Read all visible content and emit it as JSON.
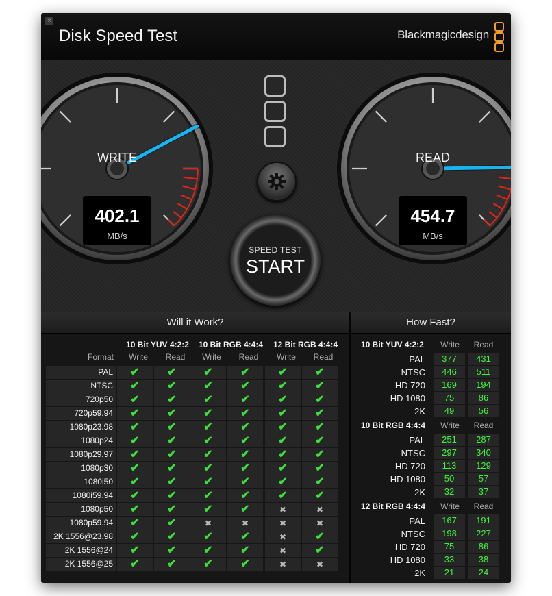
{
  "window": {
    "title": "Disk Speed Test",
    "brand": "Blackmagicdesign",
    "close_glyph": "×"
  },
  "colors": {
    "accent": "#f29b2b",
    "needle": "#19b4f0",
    "check": "#3ee03e",
    "value": "#3ef03e",
    "redzone": "#d8261a"
  },
  "gauges": {
    "write": {
      "label": "WRITE",
      "value": "402.1",
      "unit": "MB/s",
      "needle_fraction": 0.73
    },
    "read": {
      "label": "READ",
      "value": "454.7",
      "unit": "MB/s",
      "needle_fraction": 0.83
    }
  },
  "start_button": {
    "top_label": "SPEED TEST",
    "main_label": "START"
  },
  "settings_button": {
    "icon": "gear-icon"
  },
  "will_it_work": {
    "title": "Will it Work?",
    "format_header": "Format",
    "groups": [
      "10 Bit YUV 4:2:2",
      "10 Bit RGB 4:4:4",
      "12 Bit RGB 4:4:4"
    ],
    "sub_headers": [
      "Write",
      "Read",
      "Write",
      "Read",
      "Write",
      "Read"
    ],
    "rows": [
      {
        "format": "PAL",
        "cells": [
          1,
          1,
          1,
          1,
          1,
          1
        ]
      },
      {
        "format": "NTSC",
        "cells": [
          1,
          1,
          1,
          1,
          1,
          1
        ]
      },
      {
        "format": "720p50",
        "cells": [
          1,
          1,
          1,
          1,
          1,
          1
        ]
      },
      {
        "format": "720p59.94",
        "cells": [
          1,
          1,
          1,
          1,
          1,
          1
        ]
      },
      {
        "format": "1080p23.98",
        "cells": [
          1,
          1,
          1,
          1,
          1,
          1
        ]
      },
      {
        "format": "1080p24",
        "cells": [
          1,
          1,
          1,
          1,
          1,
          1
        ]
      },
      {
        "format": "1080p29.97",
        "cells": [
          1,
          1,
          1,
          1,
          1,
          1
        ]
      },
      {
        "format": "1080p30",
        "cells": [
          1,
          1,
          1,
          1,
          1,
          1
        ]
      },
      {
        "format": "1080i50",
        "cells": [
          1,
          1,
          1,
          1,
          1,
          1
        ]
      },
      {
        "format": "1080i59.94",
        "cells": [
          1,
          1,
          1,
          1,
          1,
          1
        ]
      },
      {
        "format": "1080p50",
        "cells": [
          1,
          1,
          1,
          1,
          0,
          0
        ]
      },
      {
        "format": "1080p59.94",
        "cells": [
          1,
          1,
          0,
          0,
          0,
          0
        ]
      },
      {
        "format": "2K 1556@23.98",
        "cells": [
          1,
          1,
          1,
          1,
          0,
          1
        ]
      },
      {
        "format": "2K 1556@24",
        "cells": [
          1,
          1,
          1,
          1,
          0,
          1
        ]
      },
      {
        "format": "2K 1556@25",
        "cells": [
          1,
          1,
          1,
          1,
          0,
          0
        ]
      }
    ]
  },
  "how_fast": {
    "title": "How Fast?",
    "write_label": "Write",
    "read_label": "Read",
    "groups": [
      {
        "name": "10 Bit YUV 4:2:2",
        "rows": [
          {
            "label": "PAL",
            "write": "377",
            "read": "431"
          },
          {
            "label": "NTSC",
            "write": "446",
            "read": "511"
          },
          {
            "label": "HD 720",
            "write": "169",
            "read": "194"
          },
          {
            "label": "HD 1080",
            "write": "75",
            "read": "86"
          },
          {
            "label": "2K",
            "write": "49",
            "read": "56"
          }
        ]
      },
      {
        "name": "10 Bit RGB 4:4:4",
        "rows": [
          {
            "label": "PAL",
            "write": "251",
            "read": "287"
          },
          {
            "label": "NTSC",
            "write": "297",
            "read": "340"
          },
          {
            "label": "HD 720",
            "write": "113",
            "read": "129"
          },
          {
            "label": "HD 1080",
            "write": "50",
            "read": "57"
          },
          {
            "label": "2K",
            "write": "32",
            "read": "37"
          }
        ]
      },
      {
        "name": "12 Bit RGB 4:4:4",
        "rows": [
          {
            "label": "PAL",
            "write": "167",
            "read": "191"
          },
          {
            "label": "NTSC",
            "write": "198",
            "read": "227"
          },
          {
            "label": "HD 720",
            "write": "75",
            "read": "86"
          },
          {
            "label": "HD 1080",
            "write": "33",
            "read": "38"
          },
          {
            "label": "2K",
            "write": "21",
            "read": "24"
          }
        ]
      }
    ]
  }
}
